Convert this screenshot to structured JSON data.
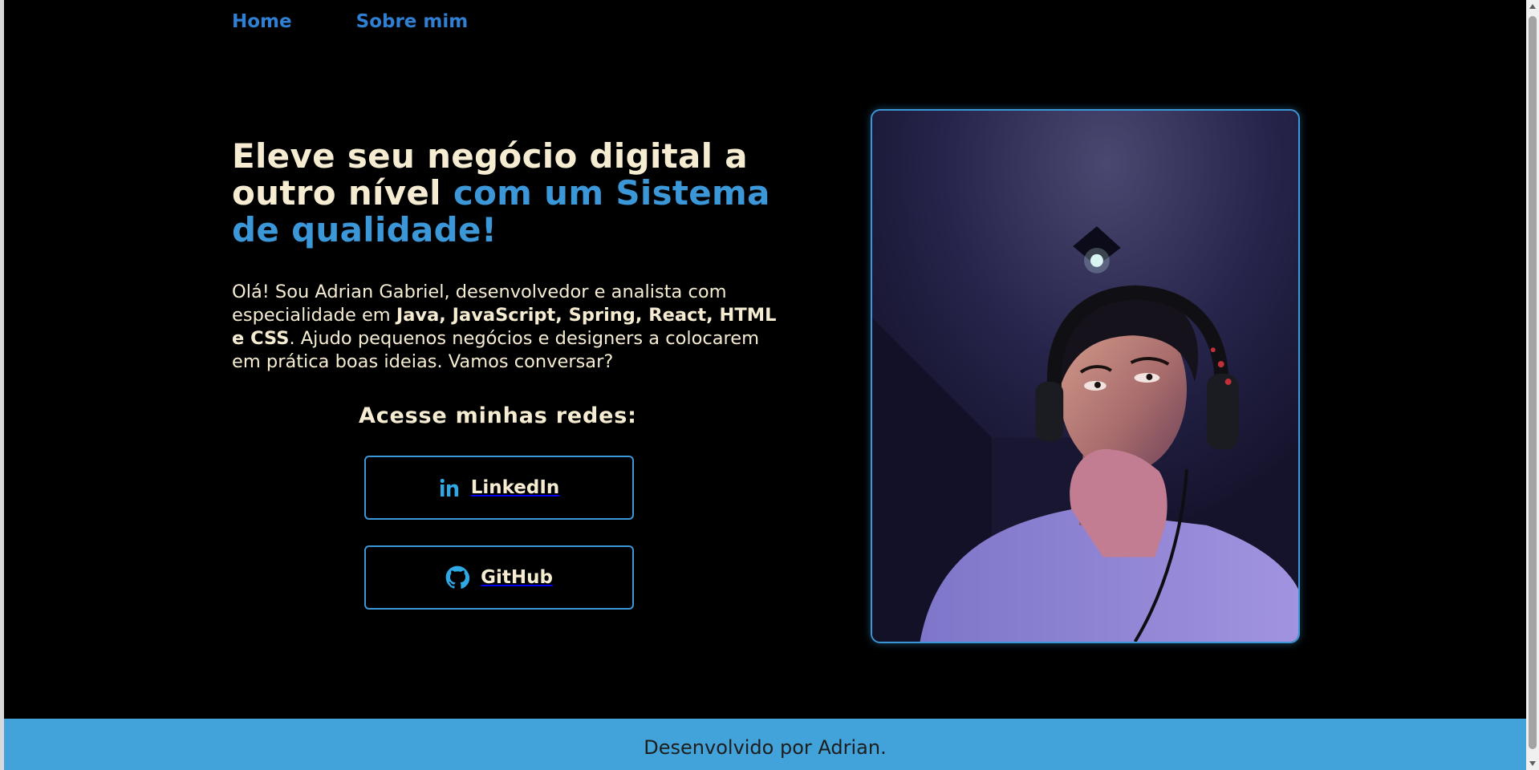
{
  "nav": {
    "home": "Home",
    "about": "Sobre mim"
  },
  "hero": {
    "title_part1": "Eleve seu negócio digital a outro nível",
    "title_accent": "com um Sistema de qualidade!",
    "intro_part1": "Olá! Sou Adrian Gabriel, desenvolvedor e analista com especialidade em",
    "intro_bold": "Java, JavaScript, Spring, React, HTML e CSS",
    "intro_part2": ". Ajudo pequenos negócios e designers a colocarem em prática boas ideias. Vamos conversar?"
  },
  "social": {
    "title": "Acesse minhas redes:",
    "linkedin_label": "LinkedIn",
    "github_label": "GitHub",
    "linkedin_icon": "linkedin-icon",
    "github_icon": "github-icon"
  },
  "photo": {
    "alt_subject": "portrait-photo"
  },
  "footer": {
    "text": "Desenvolvido por Adrian."
  },
  "colors": {
    "background": "#000000",
    "accent": "#3b97d8",
    "text_cream": "#f5ecd2",
    "footer_bg": "#42a3da",
    "nav_link": "#2f7fd3"
  }
}
